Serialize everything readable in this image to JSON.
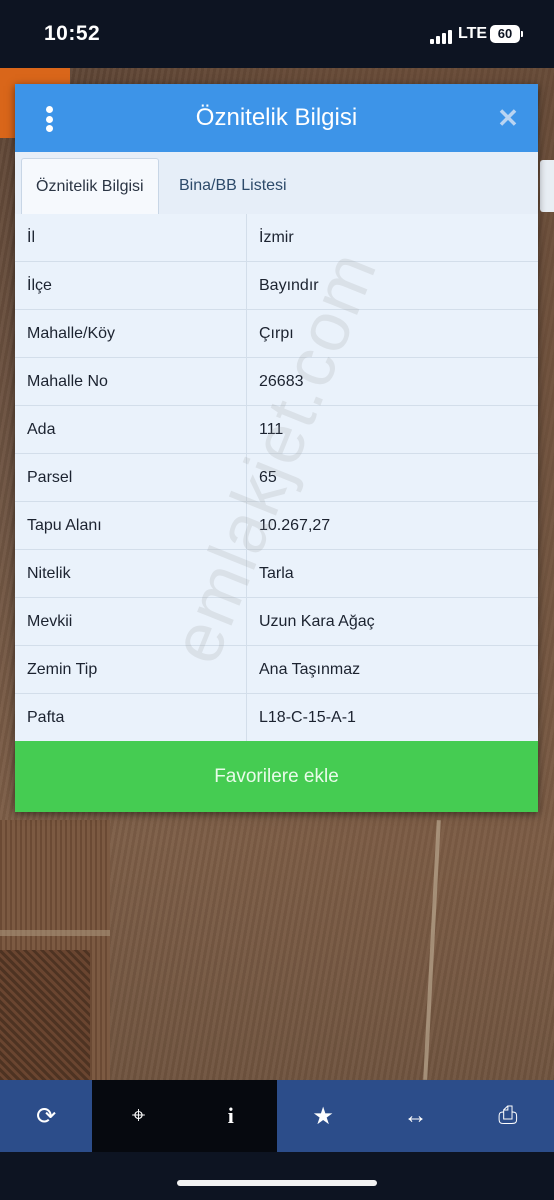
{
  "status_bar": {
    "time": "10:52",
    "network": "LTE",
    "battery": "60"
  },
  "dialog": {
    "title": "Öznitelik Bilgisi",
    "tabs": [
      {
        "label": "Öznitelik Bilgisi",
        "active": true
      },
      {
        "label": "Bina/BB Listesi",
        "active": false
      }
    ],
    "rows": [
      {
        "key": "İl",
        "value": "İzmir"
      },
      {
        "key": "İlçe",
        "value": "Bayındır"
      },
      {
        "key": "Mahalle/Köy",
        "value": "Çırpı"
      },
      {
        "key": "Mahalle No",
        "value": "26683"
      },
      {
        "key": "Ada",
        "value": "111"
      },
      {
        "key": "Parsel",
        "value": "65"
      },
      {
        "key": "Tapu Alanı",
        "value": "10.267,27"
      },
      {
        "key": "Nitelik",
        "value": "Tarla"
      },
      {
        "key": "Mevkii",
        "value": "Uzun Kara Ağaç"
      },
      {
        "key": "Zemin Tip",
        "value": "Ana Taşınmaz"
      },
      {
        "key": "Pafta",
        "value": "L18-C-15-A-1"
      }
    ],
    "favorite_button": "Favorilere ekle",
    "watermark": "emlakjet.com"
  },
  "toolbar": {
    "items": [
      {
        "icon": "refresh-icon",
        "glyph": "⟳"
      },
      {
        "icon": "crosshair-icon",
        "glyph": "⌖"
      },
      {
        "icon": "info-icon",
        "glyph": "i"
      },
      {
        "icon": "star-icon",
        "glyph": "★"
      },
      {
        "icon": "measure-icon",
        "glyph": "↔"
      },
      {
        "icon": "print-icon",
        "glyph": "⎙"
      }
    ]
  },
  "colors": {
    "header": "#3d94e8",
    "favorite": "#45cc52",
    "toolbar": "#2c4d8a",
    "row_bg": "#eaf2fb"
  }
}
